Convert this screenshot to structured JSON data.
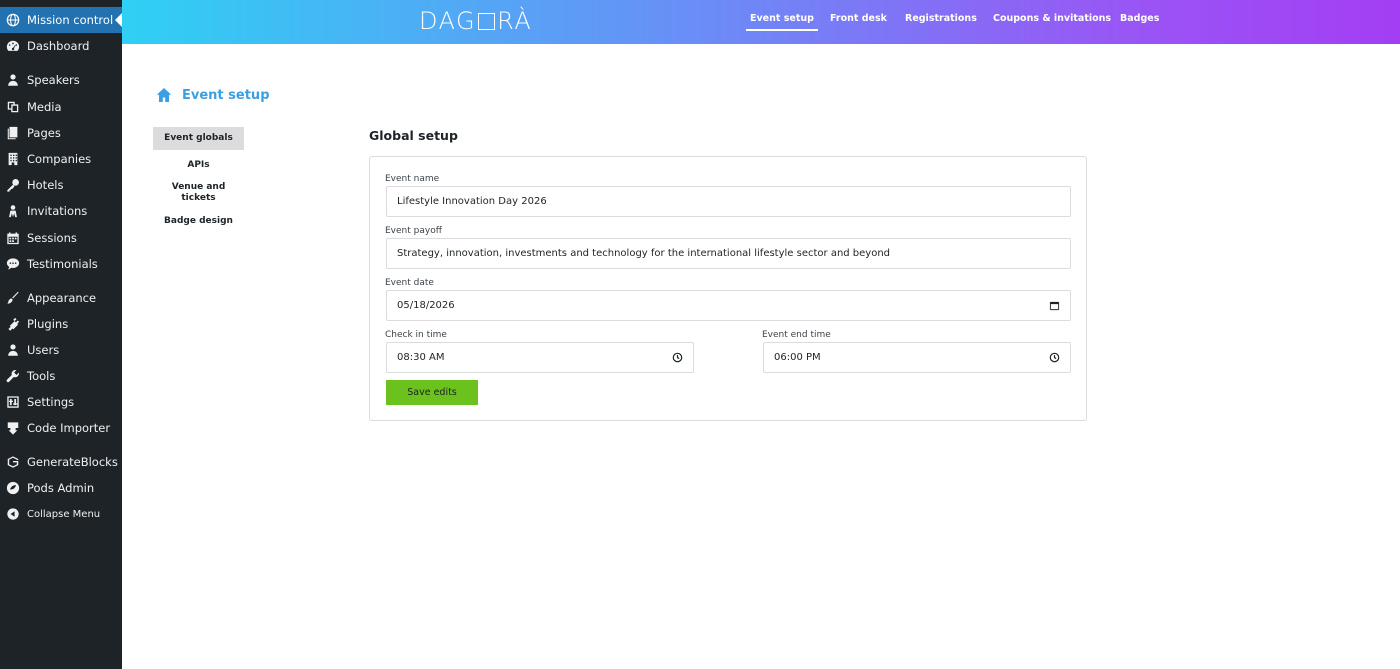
{
  "sidebar": {
    "items": [
      {
        "label": "Mission control",
        "icon": "globe-icon"
      },
      {
        "label": "Dashboard",
        "icon": "dashboard-icon"
      },
      {
        "label": "Speakers",
        "icon": "user-icon"
      },
      {
        "label": "Media",
        "icon": "media-icon"
      },
      {
        "label": "Pages",
        "icon": "pages-icon"
      },
      {
        "label": "Companies",
        "icon": "building-icon"
      },
      {
        "label": "Hotels",
        "icon": "key-icon"
      },
      {
        "label": "Invitations",
        "icon": "invitation-icon"
      },
      {
        "label": "Sessions",
        "icon": "calendar-icon"
      },
      {
        "label": "Testimonials",
        "icon": "chat-icon"
      },
      {
        "label": "Appearance",
        "icon": "brush-icon"
      },
      {
        "label": "Plugins",
        "icon": "plugin-icon"
      },
      {
        "label": "Users",
        "icon": "users-icon"
      },
      {
        "label": "Tools",
        "icon": "wrench-icon"
      },
      {
        "label": "Settings",
        "icon": "settings-icon"
      },
      {
        "label": "Code Importer",
        "icon": "import-icon"
      },
      {
        "label": "GenerateBlocks",
        "icon": "blocks-icon"
      },
      {
        "label": "Pods Admin",
        "icon": "pods-icon"
      },
      {
        "label": "Collapse Menu",
        "icon": "collapse-icon"
      }
    ]
  },
  "topbar": {
    "logo": {
      "left": "DAG",
      "right": "RÀ"
    },
    "nav": [
      "Event setup",
      "Front desk",
      "Registrations",
      "Coupons & invitations",
      "Badges"
    ],
    "active": "Event setup"
  },
  "page": {
    "title": "Event setup",
    "subnav": {
      "event_globals": "Event globals",
      "apis": "APIs",
      "venue_line1": "Venue and",
      "venue_line2": "tickets",
      "badge_design": "Badge design"
    }
  },
  "form": {
    "section_title": "Global setup",
    "event_name": {
      "label": "Event name",
      "value": "Lifestyle Innovation Day 2026"
    },
    "event_payoff": {
      "label": "Event payoff",
      "value": "Strategy, innovation, investments and technology for the international lifestyle sector and beyond"
    },
    "event_date": {
      "label": "Event date",
      "value": "05/18/2026"
    },
    "check_in": {
      "label": "Check in time",
      "value": "08:30 AM"
    },
    "end_time": {
      "label": "Event end time",
      "value": "06:00 PM"
    },
    "save_label": "Save edits"
  },
  "colors": {
    "sidebar_bg": "#1d2327",
    "active_menu": "#2271b1",
    "title_blue": "#3aa0e4",
    "save_green": "#6bc21c",
    "gradient_start": "#2fd0f4",
    "gradient_end": "#a33ef4"
  }
}
